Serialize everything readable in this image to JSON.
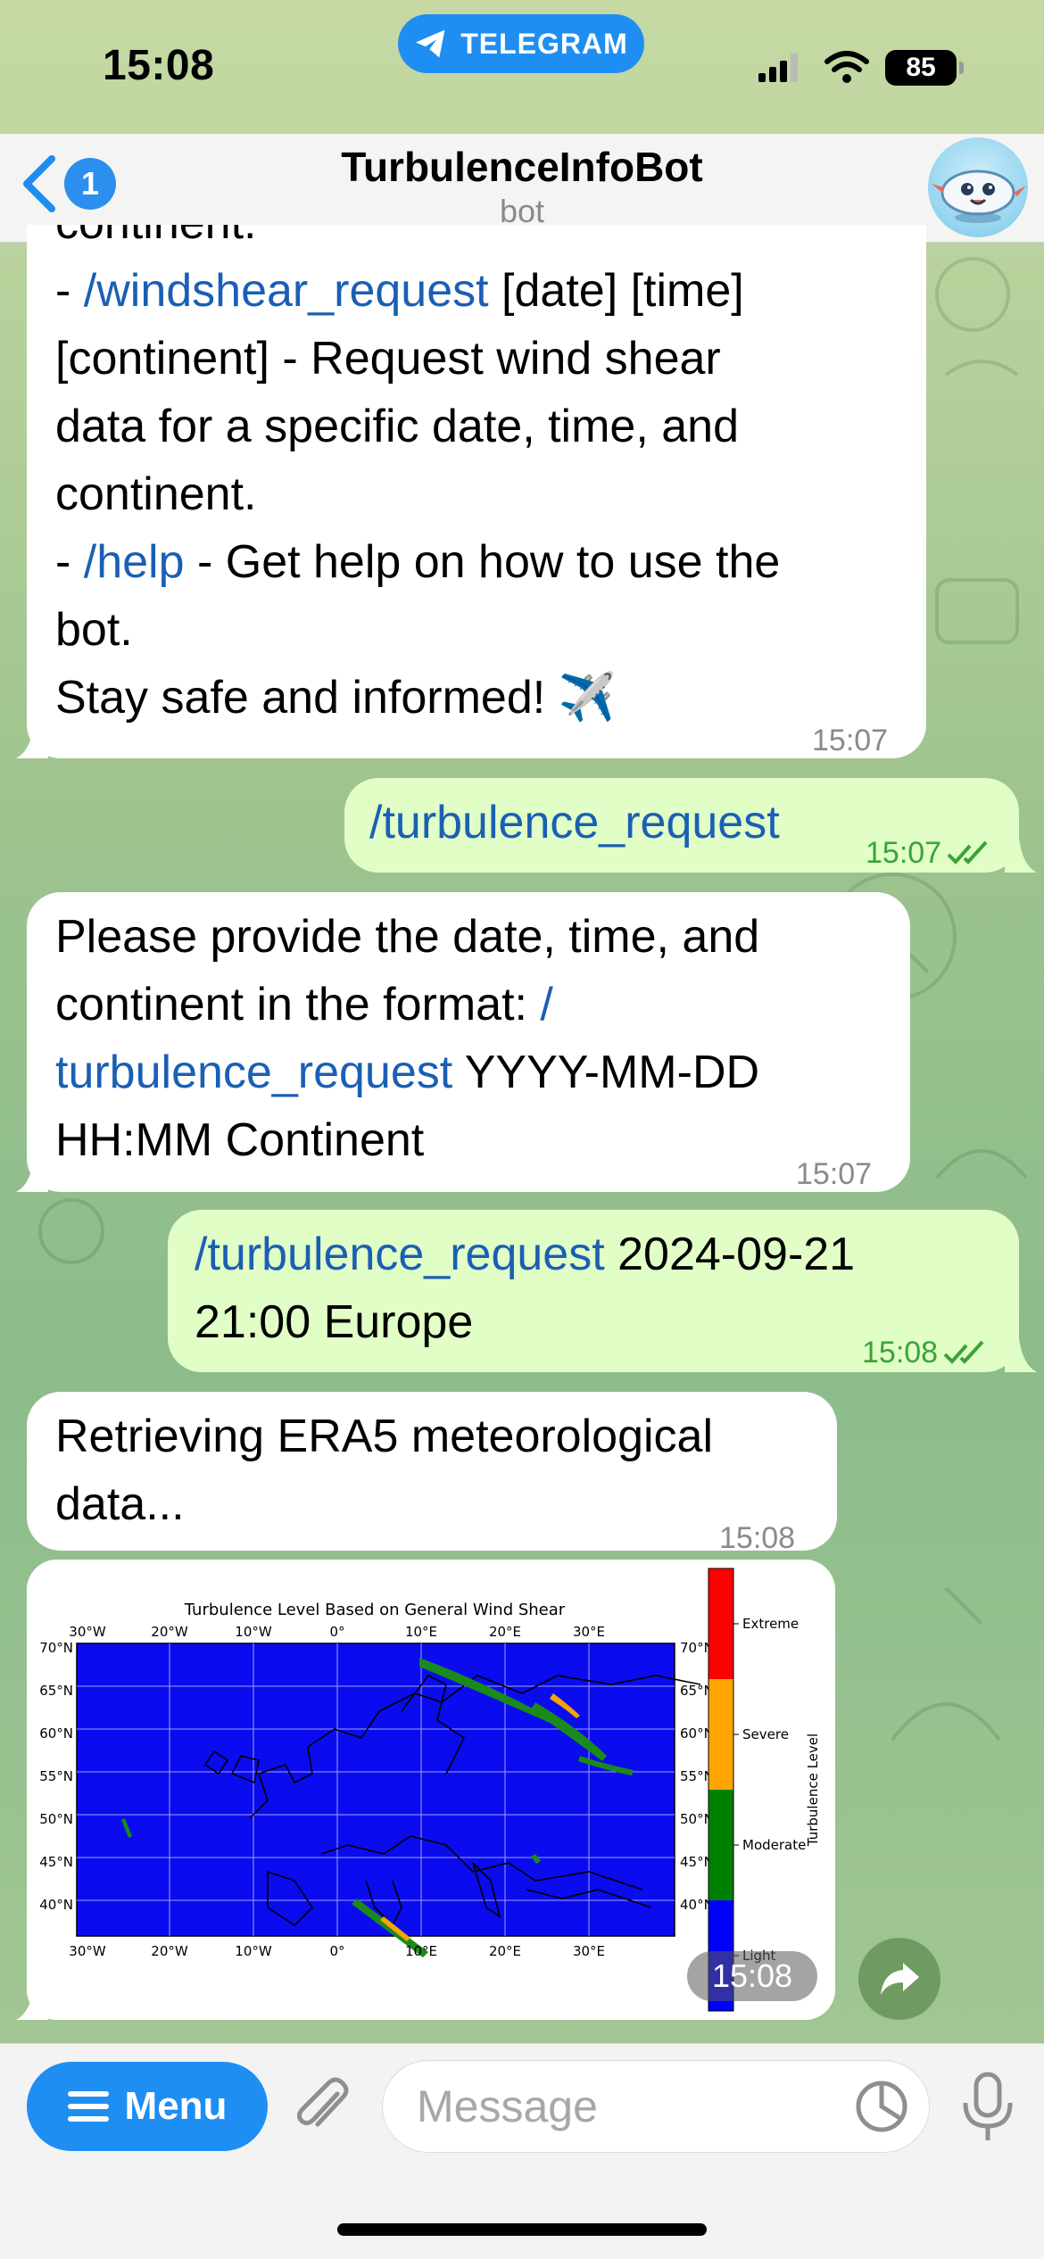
{
  "status_bar": {
    "time": "15:08",
    "app_pill": "TELEGRAM",
    "battery": "85"
  },
  "header": {
    "back_badge": "1",
    "title": "TurbulenceInfoBot",
    "subtitle": "bot"
  },
  "messages": {
    "m1": {
      "line_partial": "continent.",
      "dash1": "- ",
      "cmd1": "/windshear_request",
      "l1rest": " [date] [time]",
      "l2": "[continent] - Request wind shear",
      "l3": "data for a specific date, time, and",
      "l4": "continent.",
      "dash2": "- ",
      "cmd2": "/help",
      "l5rest": " - Get help on how to use the",
      "l6": "bot.",
      "l7": "Stay safe and informed! ✈️",
      "time": "15:07"
    },
    "m2": {
      "cmd": "/turbulence_request",
      "time": "15:07"
    },
    "m3": {
      "l1": "Please provide the date, time, and",
      "l2a": "continent in the format: ",
      "l2b": "/",
      "l3a": "turbulence_request",
      "l3b": " YYYY-MM-DD",
      "l4": "HH:MM Continent",
      "time": "15:07"
    },
    "m4": {
      "cmd": "/turbulence_request",
      "rest1": " 2024-09-21",
      "l2": "21:00 Europe",
      "time": "15:08"
    },
    "m5": {
      "l1": "Retrieving ERA5 meteorological",
      "l2": "data...",
      "time": "15:08"
    },
    "m6": {
      "time": "15:08",
      "map_title": "Turbulence Level Based on General Wind Shear",
      "lon_ticks": [
        "30°W",
        "20°W",
        "10°W",
        "0°",
        "10°E",
        "20°E",
        "30°E"
      ],
      "lat_ticks": [
        "70°N",
        "65°N",
        "60°N",
        "55°N",
        "50°N",
        "45°N",
        "40°N"
      ],
      "colorbar_label": "Turbulence Level",
      "levels": [
        "Extreme",
        "Severe",
        "Moderate",
        "Light"
      ]
    }
  },
  "input_bar": {
    "menu": "Menu",
    "placeholder": "Message"
  },
  "colors": {
    "accent": "#1e8ef2",
    "outgoing": "#e1fec6",
    "link": "#1a5fb4",
    "check": "#3aa33a"
  }
}
